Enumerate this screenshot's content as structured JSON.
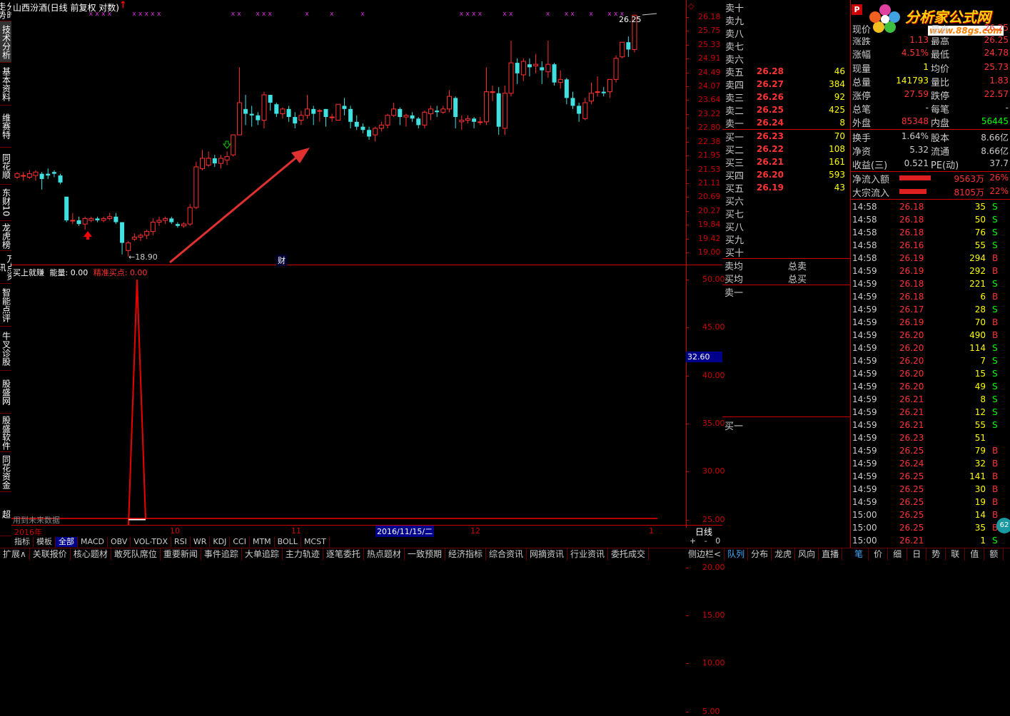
{
  "chart_title": "山西汾酒(日线 前复权 对数)",
  "left_tabs": [
    "分时走势",
    "技术分析",
    "基本资料",
    "维赛特",
    "同花顺",
    "东财10",
    "龙虎榜",
    "万点资讯",
    "智能点评",
    "牛叉诊股",
    "股盛网",
    "股盛软件",
    "同花资金",
    "超"
  ],
  "price_axis": [
    "26.18",
    "25.75",
    "25.33",
    "24.91",
    "24.49",
    "24.07",
    "23.64",
    "23.22",
    "22.80",
    "22.38",
    "21.95",
    "21.53",
    "21.11",
    "20.69",
    "20.27",
    "19.84",
    "19.42",
    "19.00"
  ],
  "high_label": "26.25",
  "low_label": "18.90",
  "cai_label": "财",
  "indicator": {
    "name": "买上就赚",
    "energy_label": "能量:",
    "energy_value": "0.00",
    "buy_label": "精准买点:",
    "buy_value": "0.00",
    "note": "用到未来数据",
    "current": "32.60"
  },
  "ind_axis": [
    "50.00",
    "45.00",
    "40.00",
    "35.00",
    "30.00",
    "25.00",
    "20.00",
    "15.00",
    "10.00",
    "5.00"
  ],
  "date_axis": {
    "year": "2016年",
    "m10": "10",
    "m11": "11",
    "cursor": "2016/11/15/二",
    "m12": "12",
    "m1": "1",
    "period": "日线"
  },
  "bottom_tabs": [
    "指标",
    "模板",
    "全部",
    "MACD",
    "OBV",
    "VOL-TDX",
    "RSI",
    "WR",
    "KDJ",
    "CCI",
    "MTM",
    "BOLL",
    "MCST"
  ],
  "footer_tabs": [
    "扩展∧",
    "关联报价",
    "核心题材",
    "敢死队席位",
    "重要新闻",
    "事件追踪",
    "大单追踪",
    "主力轨迹",
    "逐笔委托",
    "热点题材",
    "一致预期",
    "经济指标",
    "综合资讯",
    "网摘资讯",
    "行业资讯",
    "委托成交"
  ],
  "footer_right": [
    "侧边栏<",
    "队列",
    "分布",
    "龙虎",
    "风向",
    "直播",
    "笔",
    "价",
    "细",
    "日",
    "势",
    "联",
    "值",
    "额"
  ],
  "sell_book": [
    {
      "label": "卖十",
      "price": "",
      "vol": ""
    },
    {
      "label": "卖九",
      "price": "",
      "vol": ""
    },
    {
      "label": "卖八",
      "price": "",
      "vol": ""
    },
    {
      "label": "卖七",
      "price": "",
      "vol": ""
    },
    {
      "label": "卖六",
      "price": "",
      "vol": ""
    },
    {
      "label": "卖五",
      "price": "26.28",
      "vol": "46"
    },
    {
      "label": "卖四",
      "price": "26.27",
      "vol": "384"
    },
    {
      "label": "卖三",
      "price": "26.26",
      "vol": "92"
    },
    {
      "label": "卖二",
      "price": "26.25",
      "vol": "425"
    },
    {
      "label": "卖一",
      "price": "26.24",
      "vol": "8"
    }
  ],
  "buy_book": [
    {
      "label": "买一",
      "price": "26.23",
      "vol": "70"
    },
    {
      "label": "买二",
      "price": "26.22",
      "vol": "108"
    },
    {
      "label": "买三",
      "price": "26.21",
      "vol": "161"
    },
    {
      "label": "买四",
      "price": "26.20",
      "vol": "593"
    },
    {
      "label": "买五",
      "price": "26.19",
      "vol": "43"
    },
    {
      "label": "买六",
      "price": "",
      "vol": ""
    },
    {
      "label": "买七",
      "price": "",
      "vol": ""
    },
    {
      "label": "买八",
      "price": "",
      "vol": ""
    },
    {
      "label": "买九",
      "price": "",
      "vol": ""
    },
    {
      "label": "买十",
      "price": "",
      "vol": ""
    }
  ],
  "avg": {
    "sell_avg": "卖均",
    "total_sell": "总卖",
    "buy_avg": "买均",
    "total_buy": "总买",
    "sell1": "卖一",
    "buy1": "买一"
  },
  "logo": {
    "main": "分析家公式网",
    "url": "www.88gs.com"
  },
  "quote": [
    {
      "l1": "现价",
      "v1": "",
      "l2": "最高",
      "v2": "26.25"
    },
    {
      "l1": "涨跌",
      "v1": "1.13",
      "l2": "最高",
      "v2": "26.25"
    },
    {
      "l1": "涨幅",
      "v1": "4.51%",
      "l2": "最低",
      "v2": "24.78"
    },
    {
      "l1": "现量",
      "v1": "1",
      "l2": "均价",
      "v2": "25.73"
    },
    {
      "l1": "总量",
      "v1": "141793",
      "l2": "量比",
      "v2": "1.83"
    },
    {
      "l1": "涨停",
      "v1": "27.59",
      "l2": "跌停",
      "v2": "22.57"
    },
    {
      "l1": "总笔",
      "v1": "-",
      "l2": "每笔",
      "v2": "-"
    },
    {
      "l1": "外盘",
      "v1": "85348",
      "l2": "内盘",
      "v2": "56445"
    }
  ],
  "fund": [
    {
      "l1": "换手",
      "v1": "1.64%",
      "l2": "股本",
      "v2": "8.66亿"
    },
    {
      "l1": "净资",
      "v1": "5.32",
      "l2": "流通",
      "v2": "8.66亿"
    },
    {
      "l1": "收益(三)",
      "v1": "0.521",
      "l2": "PE(动)",
      "v2": "37.7"
    }
  ],
  "flow": [
    {
      "label": "净流入额",
      "amount": "9563万",
      "pct": "26%"
    },
    {
      "label": "大宗流入",
      "amount": "8105万",
      "pct": "22%"
    }
  ],
  "trades": [
    [
      "14:58",
      "26.18",
      "35",
      "S"
    ],
    [
      "14:58",
      "26.18",
      "50",
      "S"
    ],
    [
      "14:58",
      "26.18",
      "76",
      "S"
    ],
    [
      "14:58",
      "26.16",
      "55",
      "S"
    ],
    [
      "14:58",
      "26.19",
      "294",
      "B"
    ],
    [
      "14:59",
      "26.19",
      "292",
      "B"
    ],
    [
      "14:59",
      "26.18",
      "221",
      "S"
    ],
    [
      "14:59",
      "26.18",
      "6",
      "B"
    ],
    [
      "14:59",
      "26.17",
      "28",
      "S"
    ],
    [
      "14:59",
      "26.19",
      "70",
      "B"
    ],
    [
      "14:59",
      "26.20",
      "490",
      "B"
    ],
    [
      "14:59",
      "26.20",
      "114",
      "S"
    ],
    [
      "14:59",
      "26.20",
      "7",
      "S"
    ],
    [
      "14:59",
      "26.20",
      "15",
      "S"
    ],
    [
      "14:59",
      "26.20",
      "49",
      "S"
    ],
    [
      "14:59",
      "26.21",
      "8",
      "S"
    ],
    [
      "14:59",
      "26.21",
      "12",
      "S"
    ],
    [
      "14:59",
      "26.21",
      "55",
      "S"
    ],
    [
      "14:59",
      "26.23",
      "51",
      ""
    ],
    [
      "14:59",
      "26.25",
      "79",
      "B"
    ],
    [
      "14:59",
      "26.24",
      "32",
      "B"
    ],
    [
      "14:59",
      "26.25",
      "141",
      "B"
    ],
    [
      "14:59",
      "26.25",
      "30",
      "B"
    ],
    [
      "14:59",
      "26.25",
      "19",
      "B"
    ],
    [
      "15:00",
      "26.25",
      "14",
      "B"
    ],
    [
      "15:00",
      "26.25",
      "35",
      "B"
    ],
    [
      "15:00",
      "26.21",
      "1",
      "S"
    ]
  ],
  "colors": {
    "up": "#ff3030",
    "down": "#40e0e0",
    "axis": "#c00000",
    "bg": "#000000"
  },
  "candles": [
    [
      21.05,
      21.15,
      21.0,
      21.2
    ],
    [
      21.1,
      21.1,
      20.95,
      21.2
    ],
    [
      21.05,
      21.15,
      21.0,
      21.25
    ],
    [
      21.1,
      21.2,
      20.95,
      21.25
    ],
    [
      21.15,
      21.0,
      20.7,
      21.2
    ],
    [
      21.15,
      21.1,
      21.0,
      21.3
    ],
    [
      21.2,
      21.15,
      21.05,
      21.25
    ],
    [
      21.1,
      20.9,
      20.85,
      21.15
    ],
    [
      20.5,
      19.85,
      19.8,
      20.5
    ],
    [
      19.85,
      19.85,
      19.75,
      20.05
    ],
    [
      19.85,
      19.75,
      19.7,
      19.95
    ],
    [
      19.75,
      19.9,
      19.6,
      19.95
    ],
    [
      19.85,
      19.9,
      19.8,
      19.95
    ],
    [
      19.9,
      19.85,
      19.8,
      19.95
    ],
    [
      19.85,
      19.9,
      19.8,
      19.95
    ],
    [
      19.9,
      19.95,
      19.85,
      20.05
    ],
    [
      19.95,
      19.8,
      19.75,
      20.05
    ],
    [
      19.8,
      19.25,
      18.95,
      19.8
    ],
    [
      19.05,
      19.25,
      18.9,
      19.3
    ],
    [
      19.35,
      19.4,
      19.3,
      19.5
    ],
    [
      19.4,
      19.45,
      19.3,
      19.5
    ],
    [
      19.45,
      19.55,
      19.35,
      19.6
    ],
    [
      19.55,
      19.8,
      19.45,
      19.9
    ],
    [
      19.8,
      19.85,
      19.7,
      19.95
    ],
    [
      19.85,
      19.9,
      19.75,
      19.95
    ],
    [
      19.9,
      19.8,
      19.75,
      19.95
    ],
    [
      19.75,
      19.7,
      19.65,
      19.8
    ],
    [
      19.7,
      19.75,
      19.65,
      19.8
    ],
    [
      19.75,
      20.2,
      19.7,
      20.3
    ],
    [
      20.2,
      21.35,
      20.15,
      21.5
    ],
    [
      21.3,
      21.6,
      21.25,
      21.85
    ],
    [
      21.4,
      21.6,
      21.35,
      21.8
    ],
    [
      21.6,
      21.45,
      21.35,
      21.7
    ],
    [
      21.45,
      21.6,
      21.3,
      21.7
    ],
    [
      21.55,
      21.65,
      21.4,
      21.8
    ],
    [
      21.7,
      22.3,
      21.65,
      22.3
    ],
    [
      22.3,
      23.3,
      22.35,
      24.45
    ],
    [
      23.1,
      22.95,
      22.6,
      23.55
    ],
    [
      22.95,
      22.9,
      22.55,
      23.2
    ],
    [
      22.9,
      22.75,
      22.6,
      23.0
    ],
    [
      22.75,
      23.55,
      22.5,
      23.65
    ],
    [
      23.55,
      23.3,
      23.05,
      23.55
    ],
    [
      23.25,
      22.95,
      22.85,
      23.3
    ],
    [
      22.95,
      23.1,
      22.8,
      23.15
    ],
    [
      23.1,
      22.85,
      22.7,
      23.2
    ],
    [
      22.85,
      22.65,
      22.5,
      23.0
    ],
    [
      22.75,
      22.9,
      22.6,
      23.05
    ],
    [
      22.9,
      23.1,
      22.8,
      23.55
    ],
    [
      23.1,
      22.95,
      22.6,
      23.2
    ],
    [
      23.05,
      23.05,
      22.7,
      23.1
    ],
    [
      23.1,
      22.85,
      22.55,
      23.1
    ],
    [
      22.85,
      22.85,
      22.7,
      22.95
    ],
    [
      22.75,
      23.25,
      22.75,
      23.25
    ],
    [
      23.2,
      23.1,
      22.9,
      23.45
    ],
    [
      23.1,
      22.7,
      22.5,
      23.2
    ],
    [
      22.7,
      22.55,
      22.45,
      22.9
    ],
    [
      22.55,
      22.45,
      22.35,
      22.65
    ],
    [
      22.45,
      22.25,
      22.15,
      22.55
    ],
    [
      22.3,
      22.5,
      22.1,
      22.55
    ],
    [
      22.5,
      22.6,
      22.4,
      22.7
    ],
    [
      22.6,
      22.9,
      22.5,
      22.95
    ],
    [
      22.9,
      23.1,
      22.85,
      23.3
    ],
    [
      23.1,
      22.85,
      22.6,
      23.15
    ],
    [
      22.85,
      22.9,
      22.55,
      22.95
    ],
    [
      22.9,
      22.8,
      22.7,
      23.0
    ],
    [
      22.8,
      22.6,
      22.5,
      22.85
    ],
    [
      22.6,
      23.0,
      22.5,
      23.05
    ],
    [
      22.95,
      23.1,
      22.75,
      23.2
    ],
    [
      23.05,
      23.0,
      22.85,
      23.2
    ],
    [
      23.0,
      23.1,
      22.95,
      23.2
    ],
    [
      23.1,
      23.5,
      23.0,
      23.7
    ],
    [
      23.45,
      22.85,
      22.5,
      23.5
    ],
    [
      22.7,
      22.75,
      22.45,
      22.9
    ],
    [
      22.75,
      22.8,
      22.65,
      22.9
    ],
    [
      22.8,
      22.7,
      22.5,
      22.85
    ],
    [
      22.7,
      22.7,
      22.6,
      22.85
    ],
    [
      22.7,
      23.65,
      22.6,
      24.45
    ],
    [
      23.65,
      23.65,
      23.35,
      23.85
    ],
    [
      23.6,
      22.55,
      22.3,
      23.8
    ],
    [
      22.5,
      23.6,
      22.3,
      23.85
    ],
    [
      23.6,
      24.6,
      23.5,
      25.35
    ],
    [
      24.6,
      24.25,
      23.9,
      24.75
    ],
    [
      24.2,
      24.65,
      24.0,
      24.75
    ],
    [
      24.55,
      24.45,
      24.15,
      24.75
    ],
    [
      24.5,
      24.55,
      24.25,
      24.9
    ],
    [
      24.45,
      24.35,
      23.9,
      24.65
    ],
    [
      24.3,
      24.55,
      24.1,
      25.35
    ],
    [
      24.55,
      23.95,
      23.85,
      24.6
    ],
    [
      23.95,
      24.05,
      23.75,
      24.35
    ],
    [
      24.05,
      23.45,
      23.25,
      24.1
    ],
    [
      23.45,
      23.2,
      23.1,
      23.65
    ],
    [
      23.2,
      22.95,
      22.7,
      23.3
    ],
    [
      22.8,
      23.3,
      22.75,
      23.45
    ],
    [
      23.35,
      23.6,
      23.25,
      23.95
    ],
    [
      23.65,
      23.65,
      23.5,
      24.15
    ],
    [
      23.65,
      23.6,
      23.5,
      23.8
    ],
    [
      23.65,
      24.05,
      23.45,
      24.05
    ],
    [
      24.05,
      24.75,
      23.95,
      24.85
    ],
    [
      24.8,
      25.3,
      24.75,
      25.3
    ],
    [
      25.3,
      25.05,
      24.8,
      25.5
    ],
    [
      25.05,
      26.25,
      24.95,
      26.25
    ]
  ],
  "x_marks": [
    12,
    13,
    14,
    15,
    19,
    20,
    21,
    22,
    23,
    35,
    36,
    39,
    40,
    41,
    47,
    51,
    56,
    72,
    73,
    74,
    75,
    79,
    80,
    86,
    89,
    90,
    93,
    96,
    97,
    98
  ]
}
